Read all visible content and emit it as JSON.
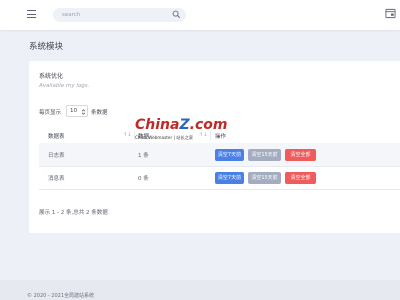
{
  "header": {
    "search_placeholder": "search"
  },
  "page": {
    "title": "系统模块"
  },
  "card": {
    "title": "系统优化",
    "subtitle": "Available my logs."
  },
  "length_menu": {
    "label_pre": "每页显示",
    "selected": "10",
    "label_post": "条数据"
  },
  "table": {
    "columns": [
      "数据表",
      "数据",
      "操作"
    ],
    "rows": [
      {
        "name": "日志表",
        "count": "1 条",
        "actions": [
          "清空7天前",
          "清空15天前",
          "清空全部"
        ]
      },
      {
        "name": "消息表",
        "count": "0 条",
        "actions": [
          "清空7天前",
          "清空15天前",
          "清空全部"
        ]
      }
    ]
  },
  "table_info": "展示 1 - 2 条,总共 2 条数据",
  "footer": {
    "text": "© 2020 - 2021全局建站系统"
  },
  "watermark": {
    "brand_a": "China",
    "brand_b": "Z",
    "brand_c": ".com",
    "subtitle": "China Webmaster | 站长之家"
  },
  "colors": {
    "primary": "#4a7fe6",
    "secondary": "#a4adbf",
    "danger": "#f05b5b",
    "background": "#edf0f6"
  }
}
